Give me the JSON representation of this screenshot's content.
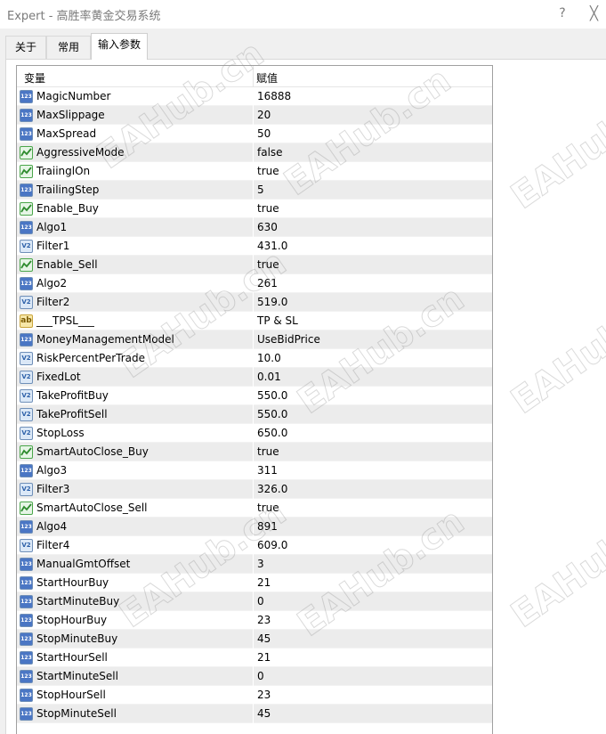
{
  "window": {
    "title": "Expert - 高胜率黄金交易系统",
    "help_label": "?",
    "close_label": "╳"
  },
  "tabs": [
    {
      "label": "关于"
    },
    {
      "label": "常用"
    },
    {
      "label": "输入参数",
      "active": true
    }
  ],
  "table": {
    "headers": {
      "variable": "变量",
      "value": "赋值"
    },
    "rows": [
      {
        "type": "int",
        "name": "MagicNumber",
        "value": "16888"
      },
      {
        "type": "int",
        "name": "MaxSlippage",
        "value": "20"
      },
      {
        "type": "int",
        "name": "MaxSpread",
        "value": "50"
      },
      {
        "type": "bool",
        "name": "AggressiveMode",
        "value": "false"
      },
      {
        "type": "bool",
        "name": "TraiinglOn",
        "value": "true"
      },
      {
        "type": "int",
        "name": "TrailingStep",
        "value": "5"
      },
      {
        "type": "bool",
        "name": "Enable_Buy",
        "value": "true"
      },
      {
        "type": "int",
        "name": "Algo1",
        "value": "630"
      },
      {
        "type": "double",
        "name": "Filter1",
        "value": "431.0"
      },
      {
        "type": "bool",
        "name": "Enable_Sell",
        "value": "true"
      },
      {
        "type": "int",
        "name": "Algo2",
        "value": "261"
      },
      {
        "type": "double",
        "name": "Filter2",
        "value": "519.0"
      },
      {
        "type": "string",
        "name": "___TPSL___",
        "value": "TP & SL"
      },
      {
        "type": "int",
        "name": "MoneyManagementModel",
        "value": "UseBidPrice"
      },
      {
        "type": "double",
        "name": "RiskPercentPerTrade",
        "value": "10.0"
      },
      {
        "type": "double",
        "name": "FixedLot",
        "value": "0.01"
      },
      {
        "type": "double",
        "name": "TakeProfitBuy",
        "value": "550.0"
      },
      {
        "type": "double",
        "name": "TakeProfitSell",
        "value": "550.0"
      },
      {
        "type": "double",
        "name": "StopLoss",
        "value": "650.0"
      },
      {
        "type": "bool",
        "name": "SmartAutoClose_Buy",
        "value": "true"
      },
      {
        "type": "int",
        "name": "Algo3",
        "value": "311"
      },
      {
        "type": "double",
        "name": "Filter3",
        "value": "326.0"
      },
      {
        "type": "bool",
        "name": "SmartAutoClose_Sell",
        "value": "true"
      },
      {
        "type": "int",
        "name": "Algo4",
        "value": "891"
      },
      {
        "type": "double",
        "name": "Filter4",
        "value": "609.0"
      },
      {
        "type": "int",
        "name": "ManualGmtOffset",
        "value": "3"
      },
      {
        "type": "int",
        "name": "StartHourBuy",
        "value": "21"
      },
      {
        "type": "int",
        "name": "StartMinuteBuy",
        "value": "0"
      },
      {
        "type": "int",
        "name": "StopHourBuy",
        "value": "23"
      },
      {
        "type": "int",
        "name": "StopMinuteBuy",
        "value": "45"
      },
      {
        "type": "int",
        "name": "StartHourSell",
        "value": "21"
      },
      {
        "type": "int",
        "name": "StartMinuteSell",
        "value": "0"
      },
      {
        "type": "int",
        "name": "StopHourSell",
        "value": "23"
      },
      {
        "type": "int",
        "name": "StopMinuteSell",
        "value": "45"
      }
    ]
  },
  "icons": {
    "int": {
      "icon": "integer-icon",
      "text": "123",
      "color": "#4a76c4"
    },
    "double": {
      "icon": "double-icon",
      "text": "V2",
      "color": "#2b5fa8"
    },
    "bool": {
      "icon": "boolean-icon",
      "text": "",
      "color": "#3c9a3c"
    },
    "string": {
      "icon": "string-icon",
      "text": "ab",
      "color": "#c9a43a"
    }
  },
  "watermark": {
    "text": "EAHub.cn"
  }
}
